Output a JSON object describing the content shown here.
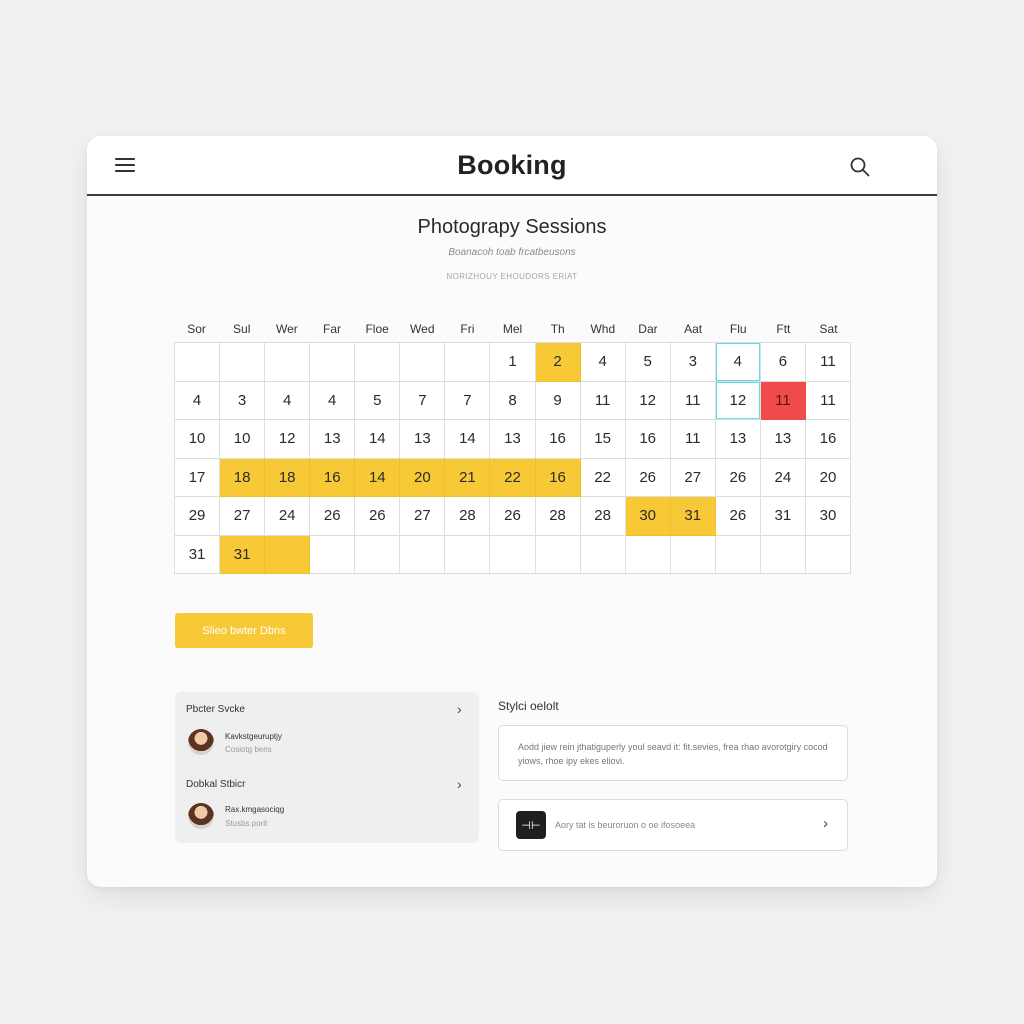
{
  "header": {
    "title": "Booking",
    "menu_icon": "hamburger-menu-icon",
    "search_icon": "search-icon"
  },
  "page": {
    "heading": "Photograpy Sessions",
    "subheading": "Boanacoh toab frcatbeusons",
    "caption": "NORIZHOUY EHOUDORS ERIAT"
  },
  "calendar": {
    "weekday_headers": [
      "Sor",
      "Sul",
      "Wer",
      "Far",
      "Floe",
      "Wed",
      "Fri",
      "Mel",
      "Th",
      "Whd",
      "Dar",
      "Aat",
      "Flu",
      "Ftt",
      "Sat"
    ],
    "rows": [
      [
        {
          "d": ""
        },
        {
          "d": ""
        },
        {
          "d": ""
        },
        {
          "d": ""
        },
        {
          "d": ""
        },
        {
          "d": ""
        },
        {
          "d": ""
        },
        {
          "d": "1"
        },
        {
          "d": "2",
          "s": "booked"
        },
        {
          "d": "4"
        },
        {
          "d": "5"
        },
        {
          "d": "3"
        },
        {
          "d": "4",
          "s": "focused"
        },
        {
          "d": "6"
        },
        {
          "d": "11"
        }
      ],
      [
        {
          "d": "4"
        },
        {
          "d": "3"
        },
        {
          "d": "4"
        },
        {
          "d": "4"
        },
        {
          "d": "5"
        },
        {
          "d": "7"
        },
        {
          "d": "7"
        },
        {
          "d": "8"
        },
        {
          "d": "9"
        },
        {
          "d": "11"
        },
        {
          "d": "12"
        },
        {
          "d": "11"
        },
        {
          "d": "12",
          "s": "focused"
        },
        {
          "d": "11",
          "s": "taken"
        },
        {
          "d": "11"
        }
      ],
      [
        {
          "d": "10"
        },
        {
          "d": "10"
        },
        {
          "d": "12"
        },
        {
          "d": "13"
        },
        {
          "d": "14"
        },
        {
          "d": "13"
        },
        {
          "d": "14"
        },
        {
          "d": "13"
        },
        {
          "d": "16"
        },
        {
          "d": "15"
        },
        {
          "d": "16"
        },
        {
          "d": "11"
        },
        {
          "d": "13"
        },
        {
          "d": "13"
        },
        {
          "d": "16"
        }
      ],
      [
        {
          "d": "17"
        },
        {
          "d": "18",
          "s": "booked"
        },
        {
          "d": "18",
          "s": "booked"
        },
        {
          "d": "16",
          "s": "booked"
        },
        {
          "d": "14",
          "s": "booked"
        },
        {
          "d": "20",
          "s": "booked"
        },
        {
          "d": "21",
          "s": "booked"
        },
        {
          "d": "22",
          "s": "booked"
        },
        {
          "d": "16",
          "s": "booked"
        },
        {
          "d": "22"
        },
        {
          "d": "26"
        },
        {
          "d": "27"
        },
        {
          "d": "26"
        },
        {
          "d": "24"
        },
        {
          "d": "20"
        }
      ],
      [
        {
          "d": "29"
        },
        {
          "d": "27"
        },
        {
          "d": "24"
        },
        {
          "d": "26"
        },
        {
          "d": "26"
        },
        {
          "d": "27"
        },
        {
          "d": "28"
        },
        {
          "d": "26"
        },
        {
          "d": "28"
        },
        {
          "d": "28"
        },
        {
          "d": "30",
          "s": "booked"
        },
        {
          "d": "31",
          "s": "booked"
        },
        {
          "d": "26"
        },
        {
          "d": "31"
        },
        {
          "d": "30"
        }
      ],
      [
        {
          "d": "31"
        },
        {
          "d": "31",
          "s": "booked"
        },
        {
          "d": "",
          "s": "booked"
        },
        {
          "d": ""
        },
        {
          "d": ""
        },
        {
          "d": ""
        },
        {
          "d": ""
        },
        {
          "d": ""
        },
        {
          "d": ""
        },
        {
          "d": ""
        },
        {
          "d": ""
        },
        {
          "d": ""
        },
        {
          "d": ""
        },
        {
          "d": ""
        },
        {
          "d": ""
        }
      ]
    ]
  },
  "select_button": {
    "label": "Slieo bwter Dbns"
  },
  "sessions_panel": {
    "sections": [
      {
        "title": "Pbcter Svcke",
        "person_name": "Kavkstgeuruptjy",
        "person_sub": "Cosiotg bens",
        "avatar_icon": "avatar-woman-icon",
        "chevron_icon": "chevron-right-icon"
      },
      {
        "title": "Dobkal Stbicr",
        "person_name": "Rax.kmgasociqg",
        "person_sub": "Stusbs porit",
        "avatar_icon": "avatar-woman-icon",
        "chevron_icon": "chevron-right-icon"
      }
    ]
  },
  "details": {
    "title": "Stylci oelolt",
    "note": "Aodd jiew rein jthatiguperly youl seavd it: fit.sevies, frea rhao avorotgiry cocod yiows, rhoe ipy ekes eliovi.",
    "action_label": "Aory tat is beuroruon o oe ifosoeea",
    "action_icon": "sliders-icon",
    "action_chevron": "chevron-right-icon"
  },
  "colors": {
    "accent": "#f7c936",
    "taken": "#ef4b4b",
    "focus": "#63dbe6"
  }
}
